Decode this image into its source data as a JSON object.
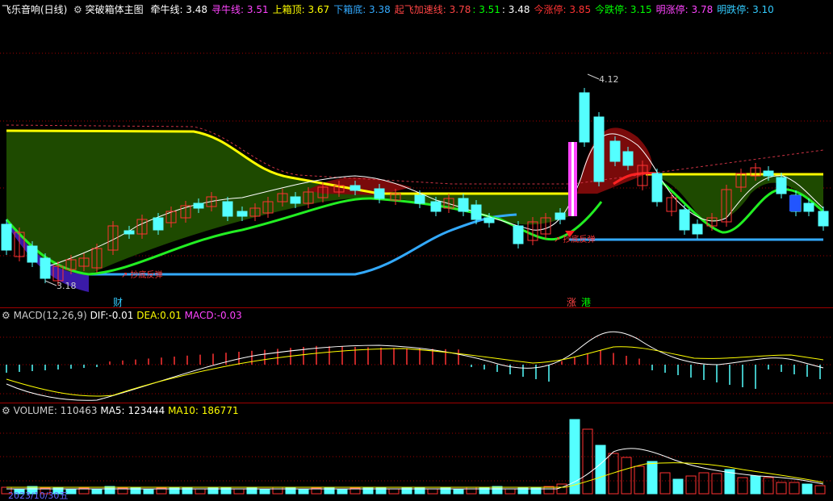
{
  "header": {
    "title": "飞乐音响(日线)",
    "indicator_name": "突破箱体主图",
    "items": [
      {
        "label": "牵牛线:",
        "value": "3.48",
        "color": "#ffffff"
      },
      {
        "label": "寻牛线:",
        "value": "3.51",
        "color": "#ff44ff"
      },
      {
        "label": "上箱顶:",
        "value": "3.67",
        "color": "#ffff00"
      },
      {
        "label": "下箱底:",
        "value": "3.38",
        "color": "#33aaff"
      },
      {
        "label": "起飞加速线:",
        "value": "3.78",
        "color": "#ff4444"
      },
      {
        "label": ":",
        "value": "3.51",
        "color": "#00ff00"
      },
      {
        "label": ":",
        "value": "3.48",
        "color": "#ffffff"
      },
      {
        "label": "今涨停:",
        "value": "3.85",
        "color": "#ff3333"
      },
      {
        "label": "今跌停:",
        "value": "3.15",
        "color": "#00ff00"
      },
      {
        "label": "明涨停:",
        "value": "3.78",
        "color": "#ff44ff"
      },
      {
        "label": "明跌停:",
        "value": "3.10",
        "color": "#33ccff"
      }
    ]
  },
  "main_chart": {
    "high_label": "4.12",
    "low_label": "3.18",
    "signal_label": "抄底反弹",
    "event_marks": [
      {
        "text": "财",
        "color": "#33ccff"
      },
      {
        "text": "涨",
        "color": "#ff4444"
      },
      {
        "text": "港",
        "color": "#00ff00"
      }
    ]
  },
  "macd": {
    "name": "MACD(12,26,9)",
    "dif_label": "DIF:",
    "dif": "-0.01",
    "dea_label": "DEA:",
    "dea": "0.01",
    "macd_label": "MACD:",
    "macd": "-0.03",
    "dif_color": "#ffffff",
    "dea_color": "#ffff00",
    "macd_color": "#ff44ff"
  },
  "volume": {
    "name": "VOLUME:",
    "vol": "110463",
    "ma5_label": "MA5:",
    "ma5": "123444",
    "ma10_label": "MA10:",
    "ma10": "186771",
    "date_label": "2023/10/30五"
  },
  "colors": {
    "up": "#ff3232",
    "down": "#54ffff",
    "grid": "#a00000",
    "box_fill": "#1e4a00",
    "box_top": "#ffff00",
    "box_bottom": "#33aaff"
  }
}
